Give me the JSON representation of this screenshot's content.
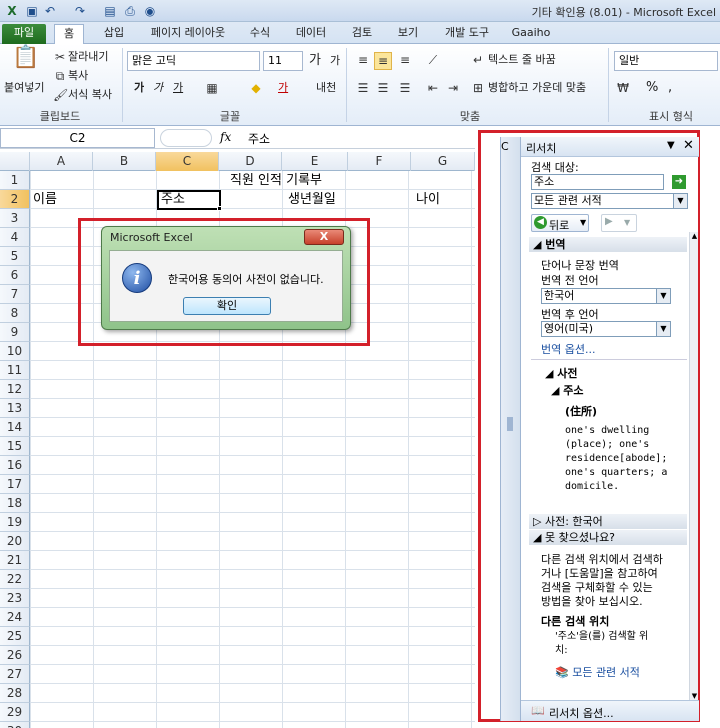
{
  "window": {
    "title": "기타 확인용 (8.01) - Microsoft Excel"
  },
  "tabs": [
    {
      "label": "파일"
    },
    {
      "label": "홈"
    },
    {
      "label": "삽입"
    },
    {
      "label": "페이지 레이아웃"
    },
    {
      "label": "수식"
    },
    {
      "label": "데이터"
    },
    {
      "label": "검토"
    },
    {
      "label": "보기"
    },
    {
      "label": "개발 도구"
    },
    {
      "label": "Gaaiho"
    }
  ],
  "ribbon": {
    "clipboard": {
      "paste_label": "붙여넣기",
      "cut_label": "잘라내기",
      "copy_label": "복사",
      "format_painter_label": "서식 복사",
      "group_label": "클립보드"
    },
    "font": {
      "font_name": "맑은 고딕",
      "font_size": "11",
      "bold": "가",
      "italic": "가",
      "underline": "가",
      "grow": "가",
      "shrink": "가",
      "font_color": "가",
      "phonetic": "내천",
      "group_label": "글꼴"
    },
    "alignment": {
      "wrap_text_label": "텍스트 줄 바꿈",
      "merge_center_label": "병합하고 가운데 맞춤",
      "group_label": "맞춤"
    },
    "number": {
      "format_value": "일반",
      "percent": "%",
      "comma": ",",
      "group_label": "표시 형식"
    }
  },
  "formula_bar": {
    "name_box": "C2",
    "fx": "fx",
    "content": "주소"
  },
  "sheet": {
    "columns": [
      "A",
      "B",
      "C",
      "D",
      "E",
      "F",
      "G"
    ],
    "rows": [
      "1",
      "2",
      "3",
      "4",
      "5",
      "6",
      "7",
      "8",
      "9",
      "10",
      "11",
      "12",
      "13",
      "14",
      "15",
      "16",
      "17",
      "18",
      "19",
      "20",
      "21",
      "22",
      "23",
      "24",
      "25",
      "26",
      "27",
      "28",
      "29",
      "30"
    ],
    "selected_cell": "C2",
    "cells": {
      "title": "직원 인적 기록부",
      "a2": "이름",
      "c2": "주소",
      "e2": "생년월일",
      "g2": "나이"
    }
  },
  "dialog": {
    "title": "Microsoft Excel",
    "close": "X",
    "message": "한국어용 동의어 사전이 없습니다.",
    "ok_label": "확인"
  },
  "research_pane": {
    "strip_label": "C",
    "title": "리서치",
    "search_label": "검색 대상:",
    "search_value": "주소",
    "source_value": "모든 관련 서적",
    "back_label": "뒤로",
    "translation": {
      "header": "번역",
      "desc": "단어나 문장 번역",
      "from_label": "번역 전 언어",
      "from_value": "한국어",
      "to_label": "번역 후 언어",
      "to_value": "영어(미국)",
      "options_link": "번역 옵션..."
    },
    "dictionary": {
      "header": "사전",
      "term": "주소",
      "hanja": "(住所)",
      "definition": [
        "one's dwelling",
        "(place); one's",
        "residence[abode];",
        "one's quarters; a",
        "domicile."
      ]
    },
    "dict_korean_header": "사전: 한국어",
    "not_found": {
      "header": "못 찾으셨나요?",
      "text": [
        "다른 검색 위치에서 검색하",
        "거나 [도움말]을 참고하여",
        "검색을 구체화할 수 있는",
        "방법을 찾아 보십시오."
      ],
      "other_locations": "다른 검색 위치",
      "search_for": [
        "'주소'을(를) 검색할 위",
        "치:"
      ],
      "all_books_link": "모든 관련 서적"
    },
    "footer_link": "리서치 옵션..."
  }
}
